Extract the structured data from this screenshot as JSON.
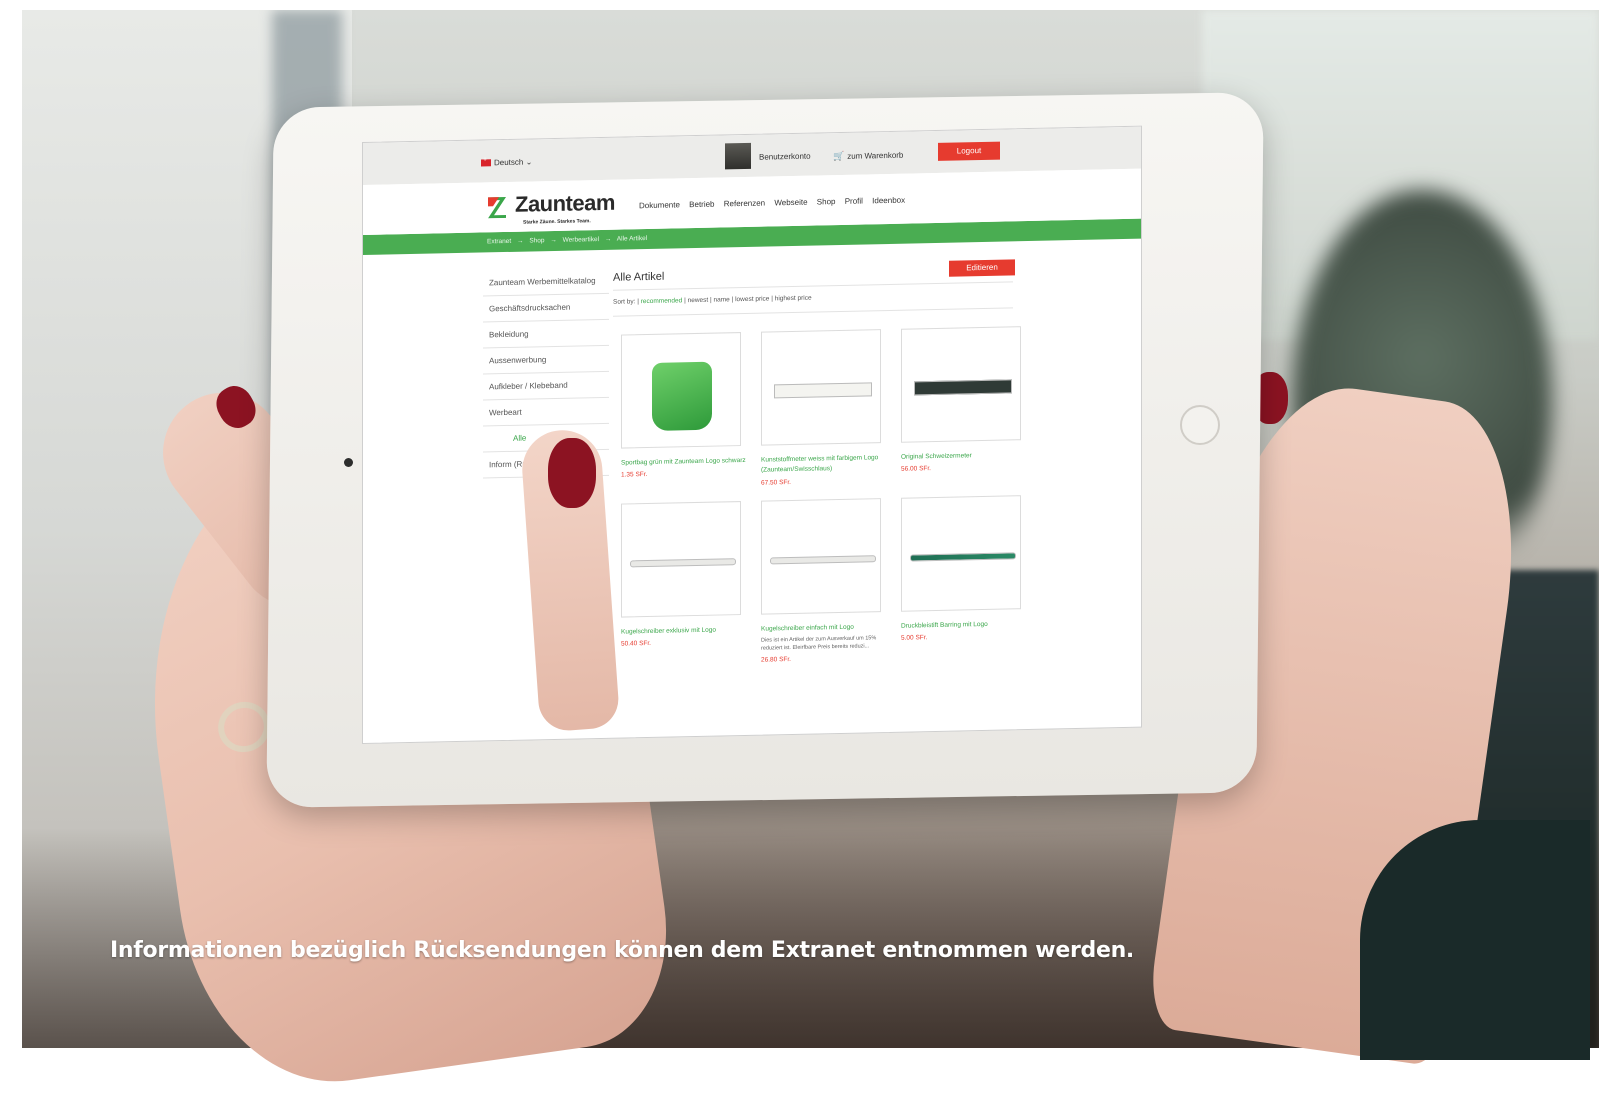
{
  "screen": {
    "language": "Deutsch ⌄",
    "account_label": "Benutzerkonto",
    "cart_label": "zum Warenkorb",
    "logout_label": "Logout",
    "brand": {
      "name": "Zaunteam",
      "tagline": "Starke Zäune. Starkes Team."
    },
    "nav": [
      "Dokumente",
      "Betrieb",
      "Referenzen",
      "Webseite",
      "Shop",
      "Profil",
      "Ideenbox"
    ],
    "breadcrumb": [
      "Extranet",
      "→",
      "Shop",
      "→",
      "Werbeartikel",
      "→",
      "Alle Artikel"
    ],
    "sidebar": [
      "Zaunteam Werbemittelkatalog",
      "Geschäftsdrucksachen",
      "Bekleidung",
      "Aussenwerbung",
      "Aufkleber / Klebeband",
      "Werbeart",
      "Alle",
      "Inform (Rück"
    ],
    "page_title": "Alle Artikel",
    "edit_label": "Editieren",
    "sort": {
      "prefix": "Sort by:",
      "options": [
        "recommended",
        "newest",
        "name",
        "lowest price",
        "highest price"
      ]
    },
    "products": [
      {
        "name": "Sportbag grün mit Zaunteam Logo schwarz",
        "price": "1.35 SFr.",
        "desc": ""
      },
      {
        "name": "Kunststoffmeter weiss mit farbigem Logo (Zaunteam/Swisschlaus)",
        "price": "67.50 SFr.",
        "desc": ""
      },
      {
        "name": "Original Schweizermeter",
        "price": "56.00 SFr.",
        "desc": ""
      },
      {
        "name": "Kugelschreiber exklusiv mit Logo",
        "price": "50.40 SFr.",
        "desc": ""
      },
      {
        "name": "Kugelschreiber einfach mit Logo",
        "price": "26.80 SFr.",
        "desc": "Dies ist ein Artikel der zum Ausverkauf um 15% reduziert ist. Eleirfbare Preis bereits reduzi..."
      },
      {
        "name": "Druckbleistift Barring mit Logo",
        "price": "5.00 SFr.",
        "desc": ""
      }
    ]
  },
  "caption": "Informationen bezüglich Rücksendungen können dem Extranet entnommen werden.",
  "colors": {
    "brand_green": "#4aad52",
    "accent_red": "#e63b2f"
  }
}
